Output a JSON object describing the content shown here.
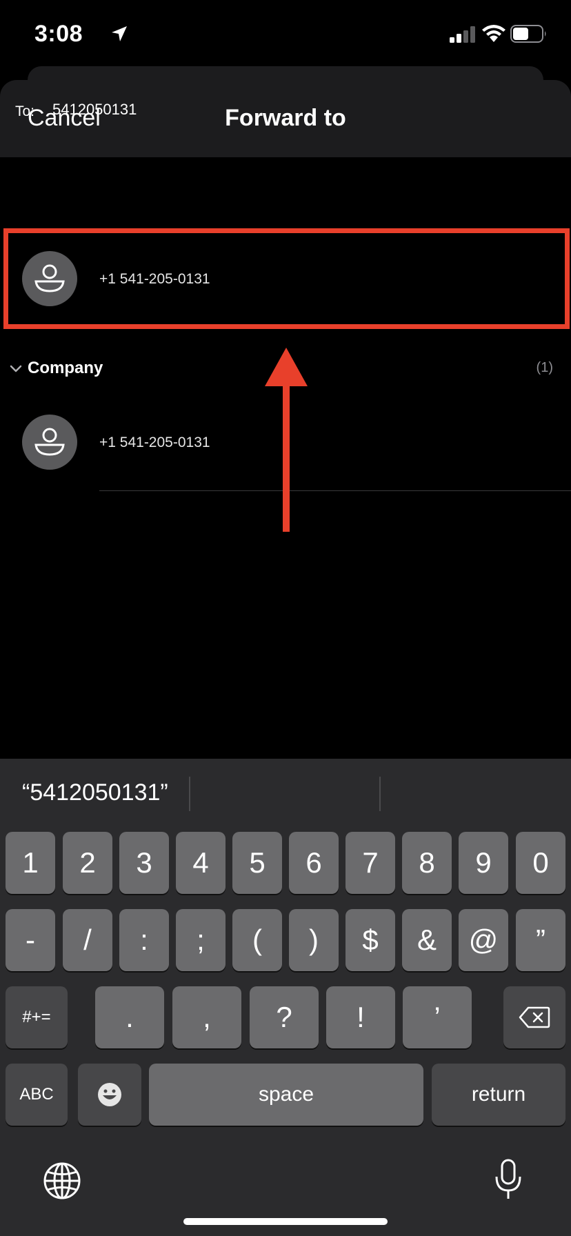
{
  "status_bar": {
    "time": "3:08"
  },
  "nav": {
    "cancel_label": "Cancel",
    "title": "Forward to"
  },
  "to_field": {
    "label": "To:",
    "value": "5412050131"
  },
  "search_result": {
    "number": "+1 541-205-0131"
  },
  "section": {
    "title": "Company",
    "count": "(1)"
  },
  "company_contact": {
    "number": "+1 541-205-0131"
  },
  "keyboard": {
    "suggestion": "“5412050131”",
    "row1": [
      "1",
      "2",
      "3",
      "4",
      "5",
      "6",
      "7",
      "8",
      "9",
      "0"
    ],
    "row2": [
      "-",
      "/",
      ":",
      ";",
      "(",
      ")",
      "$",
      "&",
      "@",
      "”"
    ],
    "row3": {
      "symbols_key": "#+=",
      "keys": [
        ".",
        ",",
        "?",
        "!",
        "’"
      ]
    },
    "row4": {
      "abc_key": "ABC",
      "space_key": "space",
      "return_key": "return"
    }
  },
  "colors": {
    "highlight": "#e8402b",
    "avatar": "#5a5a5c",
    "key": "#6b6b6d",
    "key_dark": "#474749"
  },
  "icons": [
    "location-arrow-icon",
    "signal-icon",
    "wifi-icon",
    "battery-icon",
    "person-icon",
    "chevron-down-icon",
    "delete-icon",
    "emoji-icon",
    "globe-icon",
    "microphone-icon"
  ]
}
